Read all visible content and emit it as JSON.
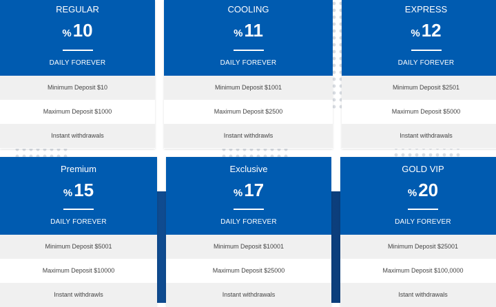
{
  "plans": [
    {
      "title": "REGULAR",
      "percent_symbol": "%",
      "rate": "10",
      "period": "DAILY FOREVER",
      "min": "Minimum Deposit $10",
      "max": "Maximum Deposit $1000",
      "withdraw": "Instant withdrawals"
    },
    {
      "title": "COOLING",
      "percent_symbol": "%",
      "rate": "11",
      "period": "DAILY FOREVER",
      "min": "Minimum Deposit $1001",
      "max": "Maximum Deposit $2500",
      "withdraw": "Instant withdrawls"
    },
    {
      "title": "EXPRESS",
      "percent_symbol": "%",
      "rate": "12",
      "period": "DAILY FOREVER",
      "min": "Minimum Deposit $2501",
      "max": "Maximum Deposit $5000",
      "withdraw": "Instant withdrawals"
    },
    {
      "title": "Premium",
      "percent_symbol": "%",
      "rate": "15",
      "period": "DAILY FOREVER",
      "min": "Minimum Deposit $5001",
      "max": "Maximum Deposit $10000",
      "withdraw": "Instant withdrawls"
    },
    {
      "title": "Exclusive",
      "percent_symbol": "%",
      "rate": "17",
      "period": "DAILY FOREVER",
      "min": "Minimum Deposit $10001",
      "max": "Maximum Deposit $25000",
      "withdraw": "Instant withdrawals"
    },
    {
      "title": "GOLD VIP",
      "percent_symbol": "%",
      "rate": "20",
      "period": "DAILY FOREVER",
      "min": "Minimum Deposit $25001",
      "max": "Maximum Deposit $100,0000",
      "withdraw": "Istant withdrawals"
    }
  ],
  "colors": {
    "header": "#005bb0",
    "row_grey": "#f0f0f0",
    "band": "#0f4c91"
  }
}
